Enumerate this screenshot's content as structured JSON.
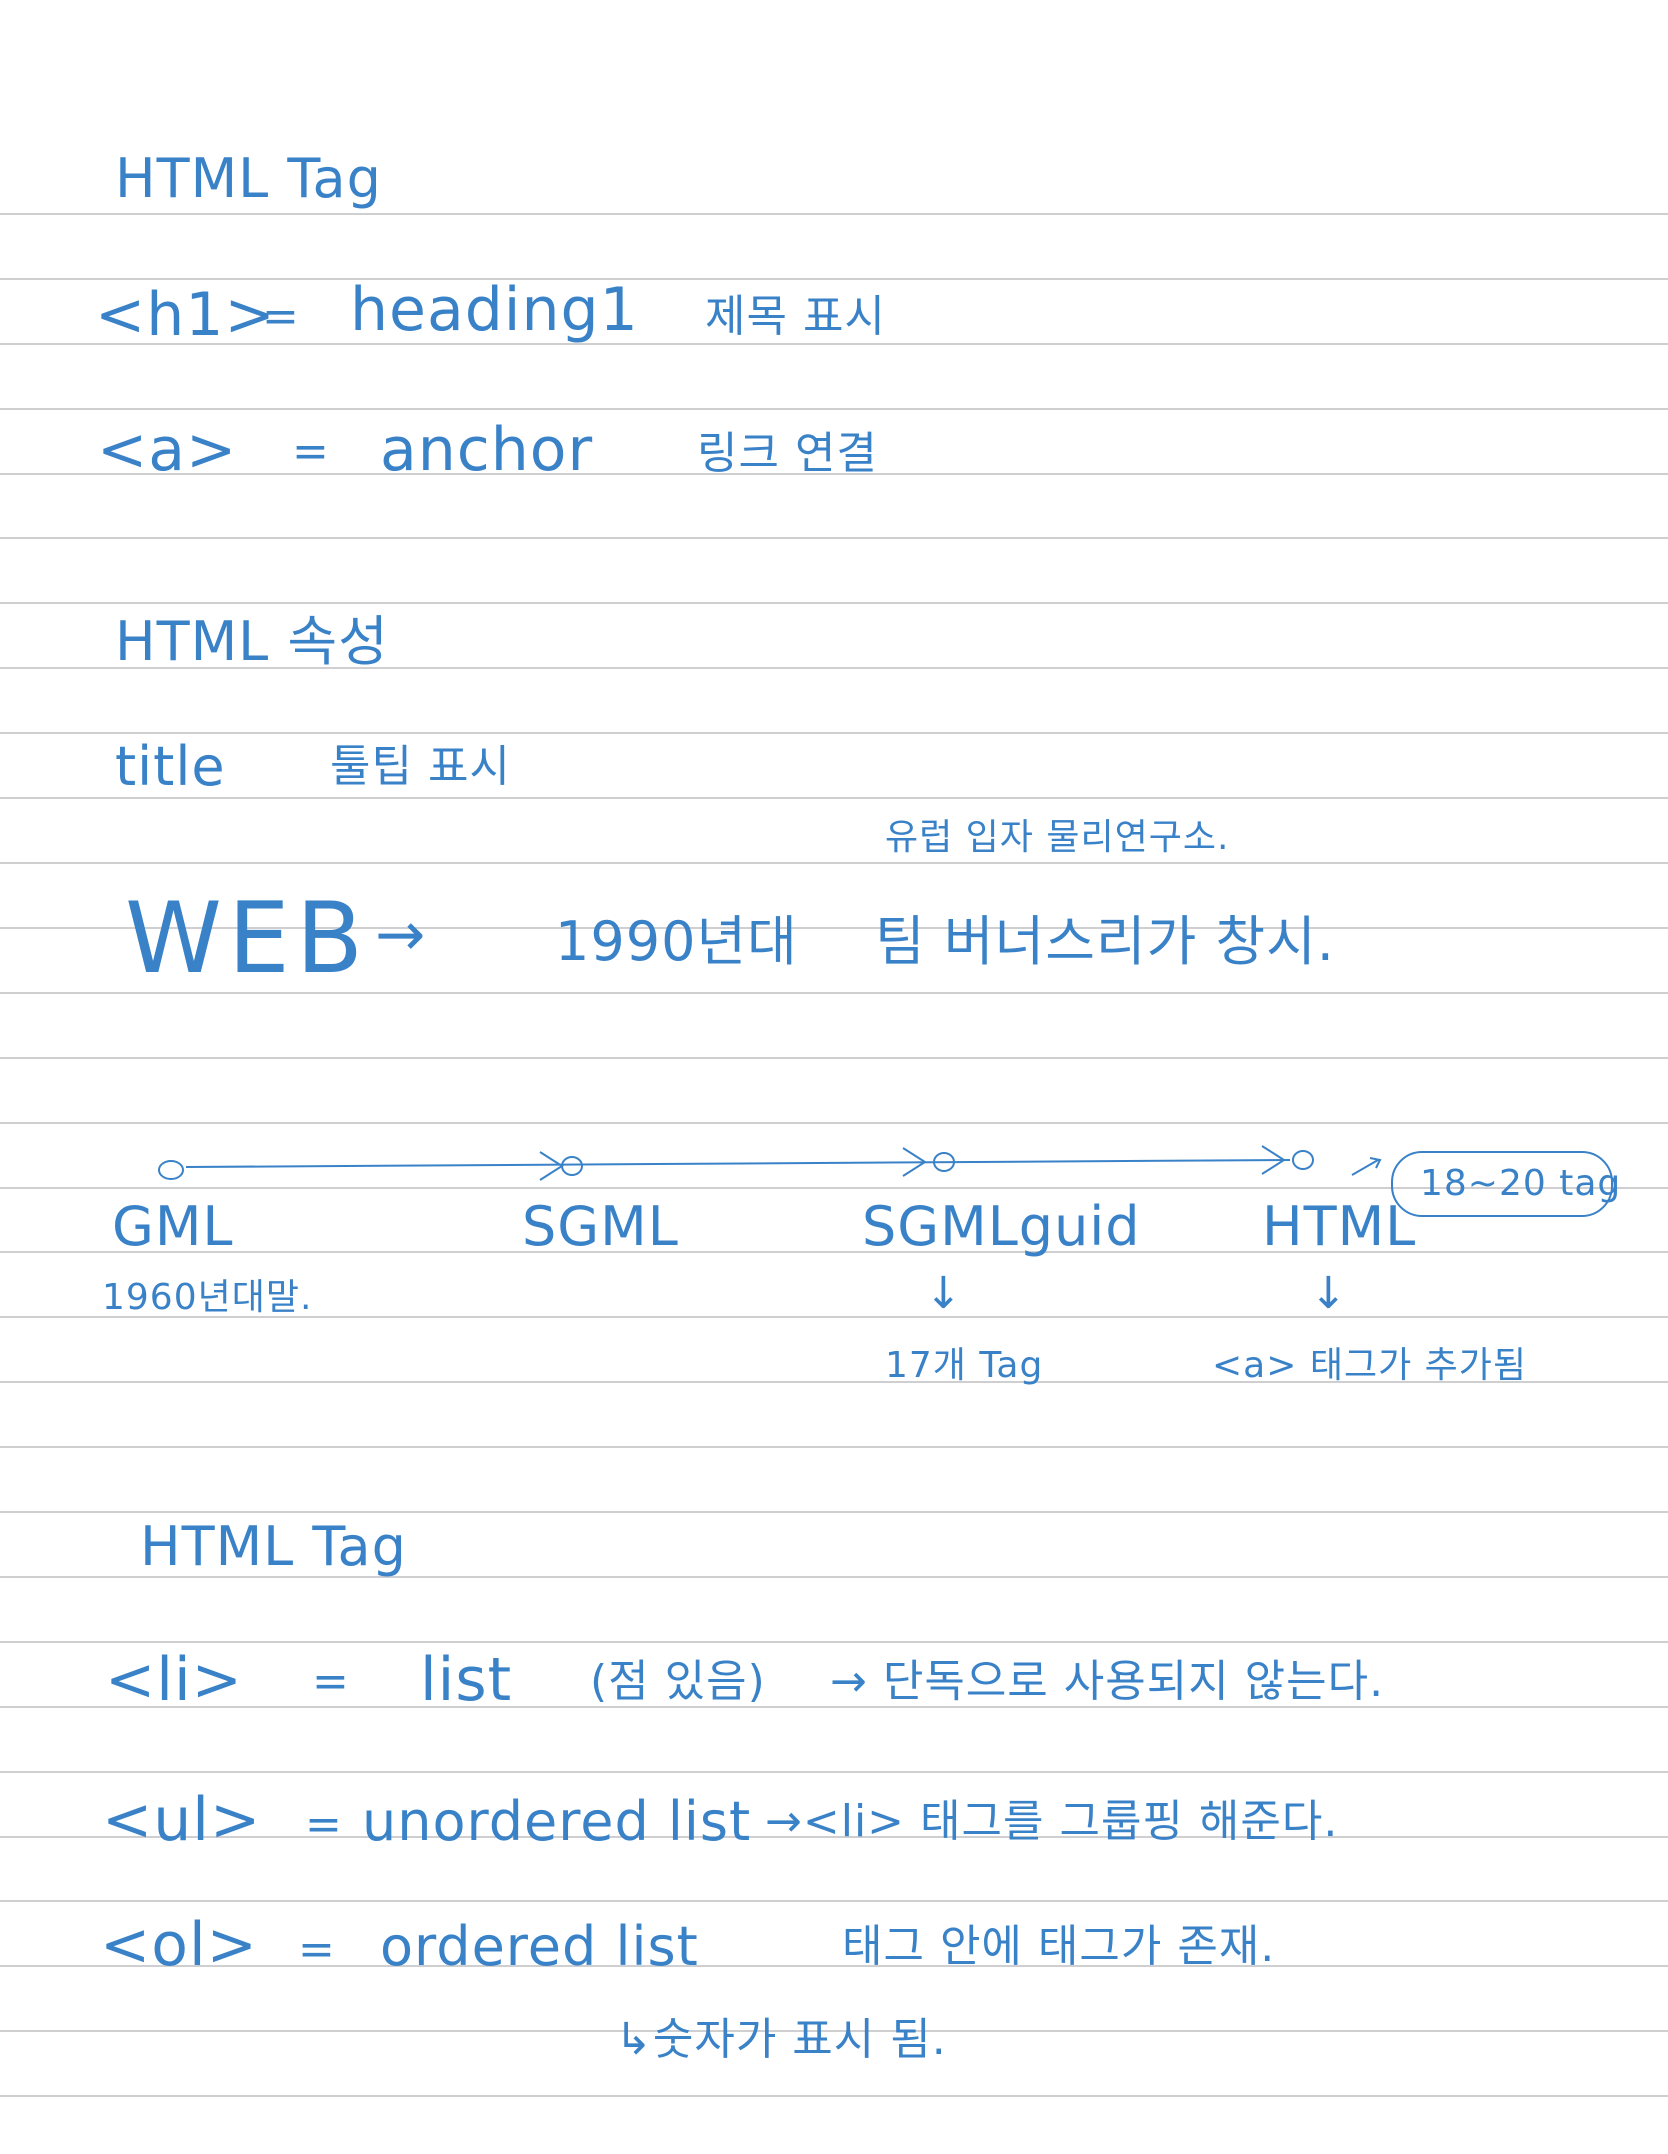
{
  "section1": {
    "title": "HTML Tag",
    "rows": [
      {
        "tag": "<h1>",
        "eq": "=",
        "name": "heading1",
        "note": "제목 표시"
      },
      {
        "tag": "<a>",
        "eq": "=",
        "name": "anchor",
        "note": "링크 연결"
      }
    ]
  },
  "section2": {
    "title": "HTML 속성",
    "attr": "title",
    "attr_note": "툴팁 표시"
  },
  "web": {
    "label": "WEB",
    "arrow": "→",
    "year": "1990년대",
    "person": "팀 버너스리가 창시.",
    "annotation": "유럽 입자 물리연구소."
  },
  "timeline": {
    "nodes": [
      {
        "label": "GML",
        "sub": "1960년대말."
      },
      {
        "label": "SGML"
      },
      {
        "label": "SGMLguid",
        "arrow": "↓",
        "sub": "17개 Tag"
      },
      {
        "label": "HTML",
        "arrow": "↓",
        "sub": "<a> 태그가 추가됨",
        "bubble": "18~20 tag"
      }
    ]
  },
  "section3": {
    "title": "HTML Tag",
    "rows": [
      {
        "tag": "<li>",
        "eq": "=",
        "name": "list",
        "extra": "(점 있음)",
        "note": "→ 단독으로 사용되지 않는다."
      },
      {
        "tag": "<ul>",
        "eq": "=",
        "name": "unordered list",
        "note": "→<li> 태그를 그룹핑 해준다."
      },
      {
        "tag": "<ol>",
        "eq": "=",
        "name": "ordered list",
        "note": "태그 안에 태그가 존재."
      }
    ],
    "footnote": "↳숫자가 표시 됨."
  }
}
